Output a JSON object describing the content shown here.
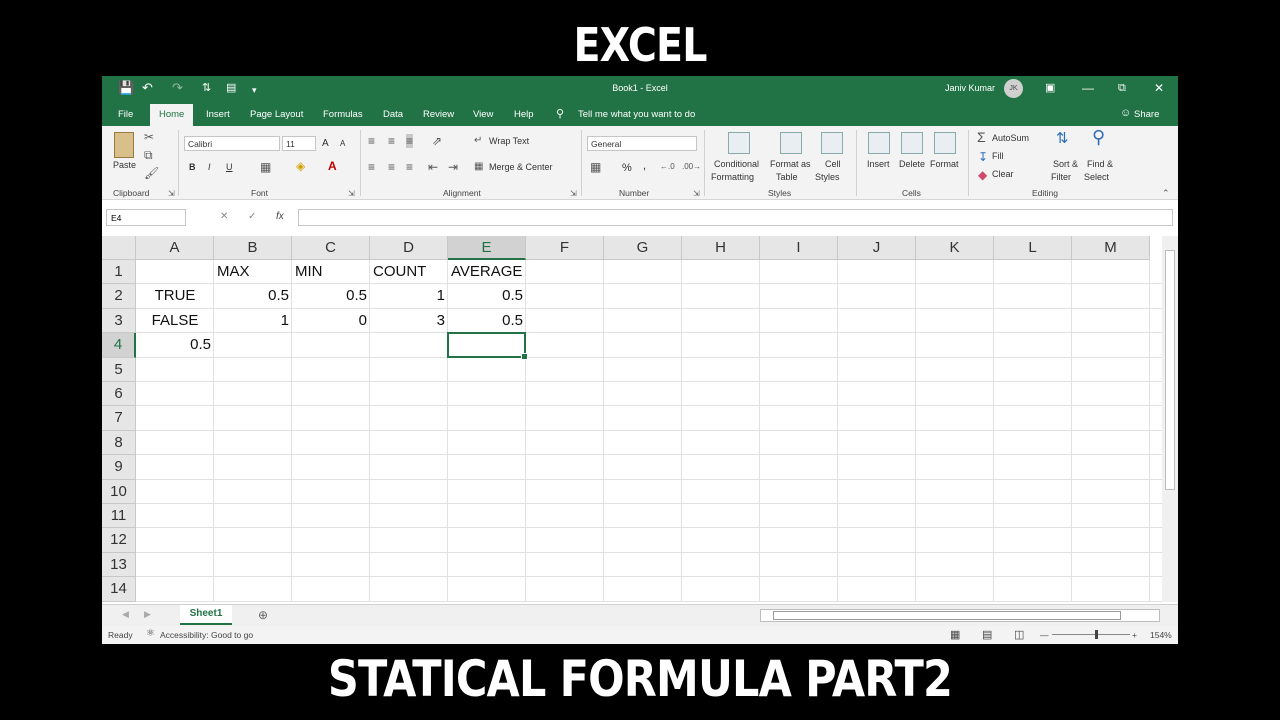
{
  "captions": {
    "top": "EXCEL",
    "bottom": "STATICAL FORMULA PART2"
  },
  "window": {
    "title": "Book1 - Excel",
    "user": "Janiv Kumar",
    "user_initials": "JK"
  },
  "tabs": [
    "File",
    "Home",
    "Insert",
    "Page Layout",
    "Formulas",
    "Data",
    "Review",
    "View",
    "Help"
  ],
  "tell_me": "Tell me what you want to do",
  "share": "Share",
  "ribbon": {
    "clipboard": {
      "paste": "Paste",
      "label": "Clipboard"
    },
    "font": {
      "name": "Calibri",
      "size": "11",
      "bold": "B",
      "italic": "I",
      "underline": "U",
      "grow": "A",
      "shrink": "A",
      "label": "Font"
    },
    "alignment": {
      "wrap": "Wrap Text",
      "merge": "Merge & Center",
      "label": "Alignment"
    },
    "number": {
      "format": "General",
      "percent": "%",
      "comma": ",",
      "label": "Number"
    },
    "styles": {
      "conditional_1": "Conditional",
      "conditional_2": "Formatting",
      "format_table_1": "Format as",
      "format_table_2": "Table",
      "cell_styles_1": "Cell",
      "cell_styles_2": "Styles",
      "label": "Styles"
    },
    "cells": {
      "insert": "Insert",
      "delete": "Delete",
      "format": "Format",
      "label": "Cells"
    },
    "editing": {
      "autosum": "AutoSum",
      "fill": "Fill",
      "clear": "Clear",
      "sort_1": "Sort &",
      "sort_2": "Filter",
      "find_1": "Find &",
      "find_2": "Select",
      "label": "Editing"
    }
  },
  "formula_bar": {
    "name_box": "E4",
    "fx": "fx",
    "content": ""
  },
  "columns": [
    "A",
    "B",
    "C",
    "D",
    "E",
    "F",
    "G",
    "H",
    "I",
    "J",
    "K",
    "L",
    "M"
  ],
  "rows": [
    "1",
    "2",
    "3",
    "4",
    "5",
    "6",
    "7",
    "8",
    "9",
    "10",
    "11",
    "12",
    "13",
    "14"
  ],
  "cells": {
    "B1": "MAX",
    "C1": "MIN",
    "D1": "COUNT",
    "E1": "AVERAGE",
    "A2": "TRUE",
    "B2": "0.5",
    "C2": "0.5",
    "D2": "1",
    "E2": "0.5",
    "A3": "FALSE",
    "B3": "1",
    "C3": "0",
    "D3": "3",
    "E3": "0.5",
    "A4": "0.5"
  },
  "selected_cell": "E4",
  "sheet_tab": "Sheet1",
  "status": {
    "ready": "Ready",
    "accessibility": "Accessibility: Good to go",
    "zoom": "154%"
  },
  "colors": {
    "accent": "#217346",
    "ribbon": "#f3f3f3",
    "grid_line": "#e1e1e1"
  }
}
